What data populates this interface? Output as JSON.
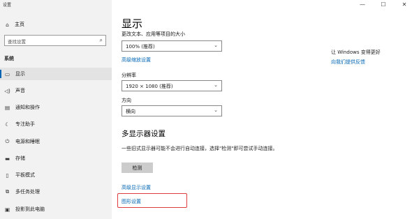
{
  "window": {
    "title": "设置",
    "controls": {
      "minimize": "—",
      "maximize": "☐",
      "close": "✕"
    }
  },
  "sidebar": {
    "home_label": "主页",
    "search_placeholder": "查找设置",
    "section_label": "系统",
    "items": [
      {
        "label": "显示",
        "icon": "monitor-icon",
        "glyph": "▭",
        "active": true
      },
      {
        "label": "声音",
        "icon": "speaker-icon",
        "glyph": "◁)"
      },
      {
        "label": "通知和操作",
        "icon": "message-icon",
        "glyph": "▤"
      },
      {
        "label": "专注助手",
        "icon": "moon-icon",
        "glyph": "☾"
      },
      {
        "label": "电源和睡眠",
        "icon": "power-icon",
        "glyph": "⏻"
      },
      {
        "label": "存储",
        "icon": "storage-icon",
        "glyph": "▬"
      },
      {
        "label": "平板模式",
        "icon": "tablet-icon",
        "glyph": "▯"
      },
      {
        "label": "多任务处理",
        "icon": "multitask-icon",
        "glyph": "⧉"
      },
      {
        "label": "投影到此电脑",
        "icon": "project-icon",
        "glyph": "▣"
      }
    ]
  },
  "main": {
    "title": "显示",
    "scale_label": "更改文本、应用等项目的大小",
    "scale_value": "100% (推荐)",
    "advanced_scale_link": "高级缩放设置",
    "resolution_label": "分辨率",
    "resolution_value": "1920 × 1080 (推荐)",
    "orientation_label": "方向",
    "orientation_value": "横向",
    "multi_display_title": "多显示器设置",
    "multi_display_desc": "一些旧式显示器可能不会进行自动连接，选择\"检测\"即可尝试手动连接。",
    "detect_button": "检测",
    "advanced_display_link": "高级显示设置",
    "graphics_link": "图形设置"
  },
  "right_panel": {
    "title": "让 Windows 变得更好",
    "feedback_link": "向我们提供反馈"
  },
  "colors": {
    "accent": "#0066b4",
    "highlight_box": "#e03c3c",
    "sidebar_bg": "#f2f2f2"
  }
}
